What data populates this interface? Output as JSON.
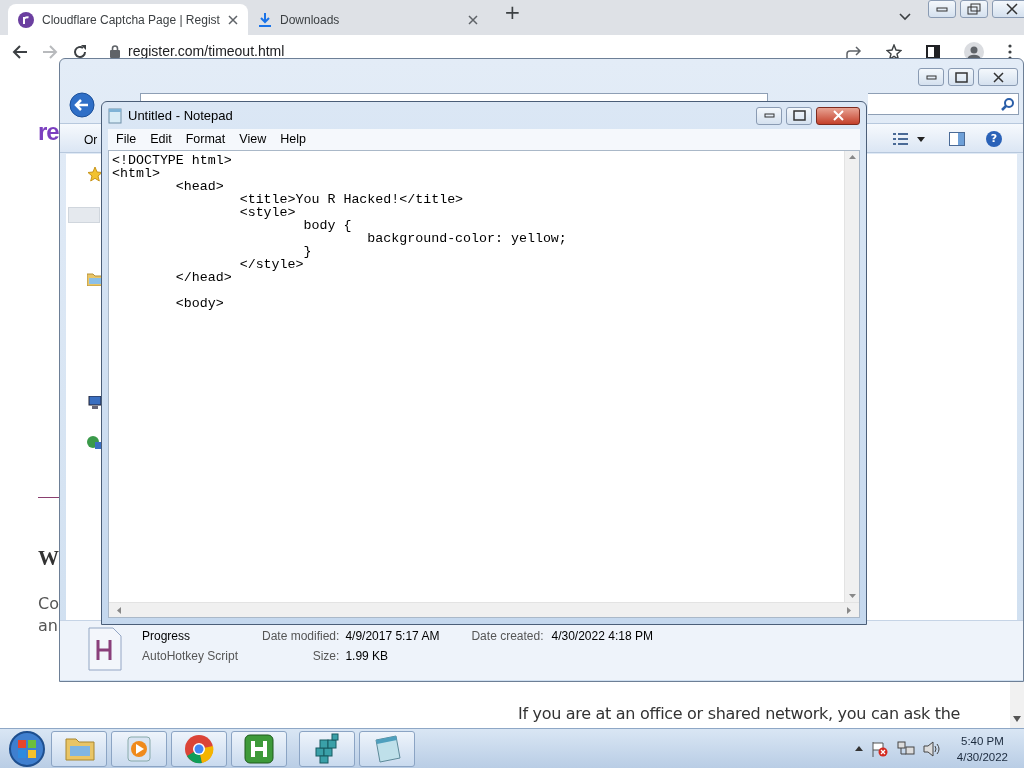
{
  "browser": {
    "tabs": [
      {
        "title": "Cloudflare Captcha Page | Regist",
        "kind": "site",
        "selected": true
      },
      {
        "title": "Downloads",
        "kind": "download",
        "selected": false
      }
    ],
    "new_tab": "+",
    "url": "register.com/timeout.html",
    "forward_disabled": true
  },
  "page": {
    "logo_fragment": "re",
    "heading_fragment": "W",
    "text_fragments": [
      "Co",
      "an"
    ],
    "bottom_text": "If you are at an office or shared network, you can ask the"
  },
  "explorer": {
    "toolbar_fragment": "Or",
    "help_glyph": "?",
    "details": {
      "name": "Progress",
      "type": "AutoHotkey Script",
      "modified_label": "Date modified:",
      "modified": "4/9/2017 5:17 AM",
      "size_label": "Size:",
      "size": "1.99 KB",
      "created_label": "Date created:",
      "created": "4/30/2022 4:18 PM"
    }
  },
  "notepad": {
    "title": "Untitled - Notepad",
    "menu": [
      "File",
      "Edit",
      "Format",
      "View",
      "Help"
    ],
    "content": "<!DOCTYPE html>\n<html>\n\t<head>\n\t\t<title>You R Hacked!</title>\n\t\t<style>\n\t\t\tbody {\n\t\t\t\tbackground-color: yellow;\n\t\t\t}\n\t\t</style>\n\t</head>\n\n\t<body>"
  },
  "taskbar": {
    "time": "5:40 PM",
    "date": "4/30/2022"
  }
}
